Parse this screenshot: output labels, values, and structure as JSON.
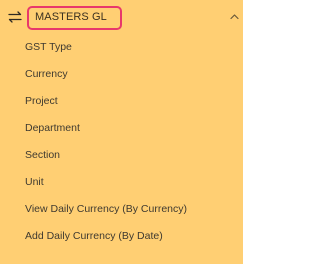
{
  "header": {
    "title": "MASTERS GL",
    "toggle_icon": "swap-arrows-icon",
    "collapse_icon": "chevron-up-icon"
  },
  "menu": {
    "items": [
      {
        "label": "GST Type"
      },
      {
        "label": "Currency"
      },
      {
        "label": "Project"
      },
      {
        "label": "Department"
      },
      {
        "label": "Section"
      },
      {
        "label": "Unit"
      },
      {
        "label": "View Daily Currency (By Currency)"
      },
      {
        "label": "Add Daily Currency (By Date)"
      }
    ]
  },
  "colors": {
    "panel_background": "#ffcf73",
    "highlight_border": "#e8386b",
    "text": "#3f3a30"
  }
}
